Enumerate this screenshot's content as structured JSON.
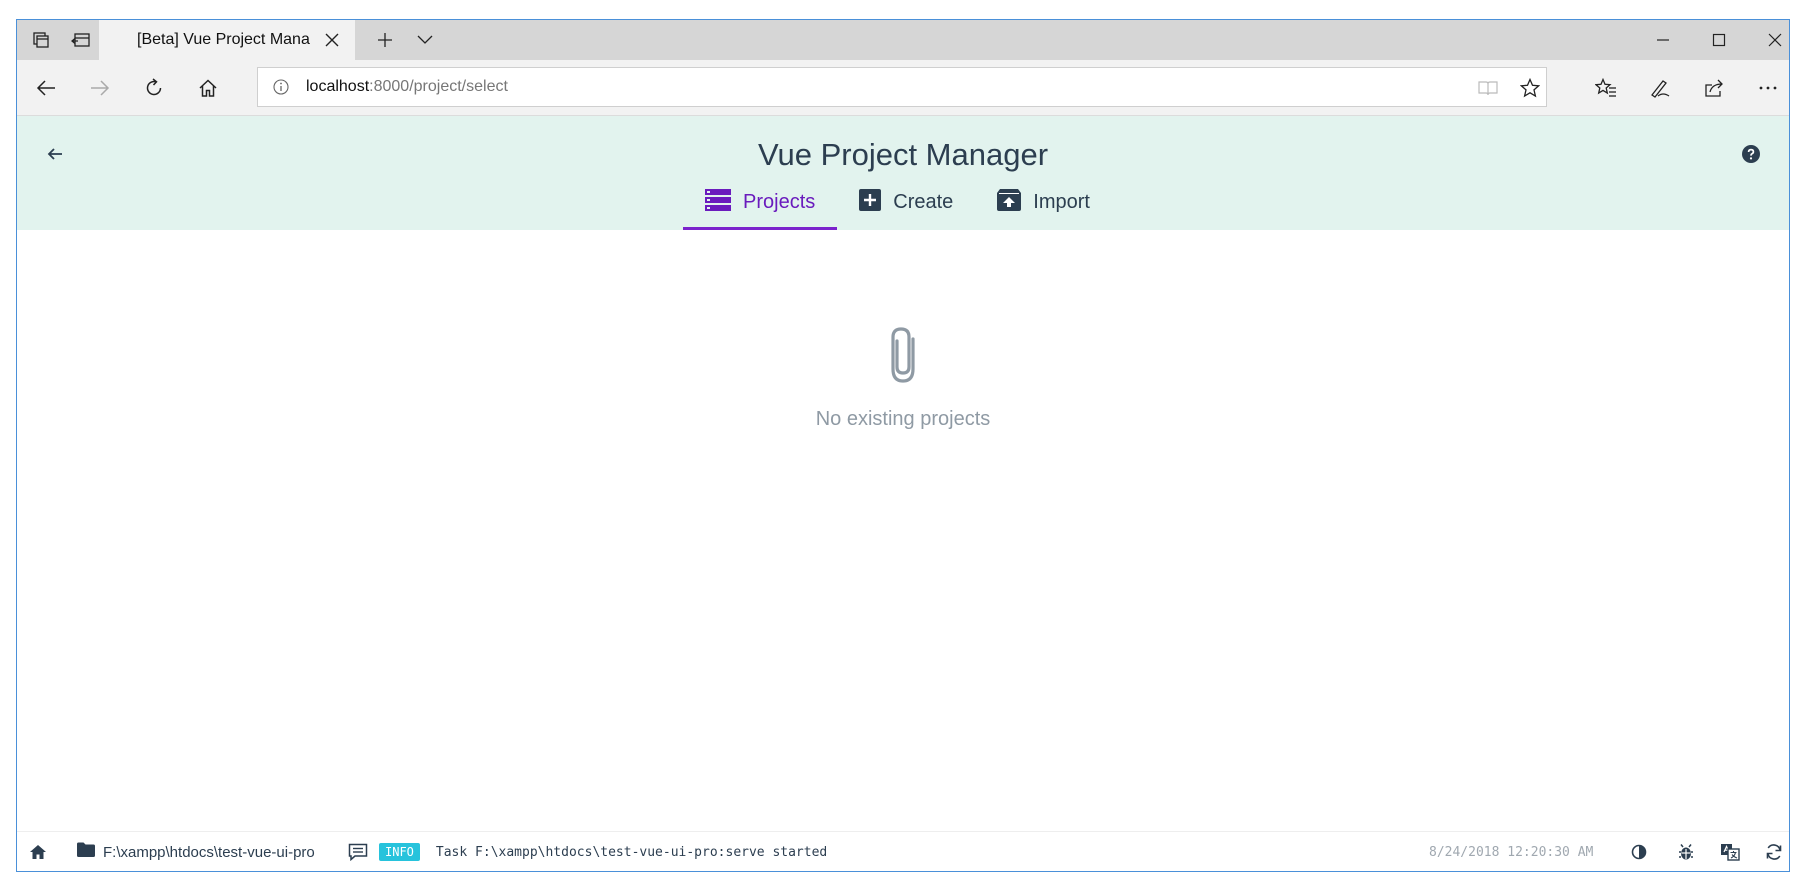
{
  "browser": {
    "tab_title": "[Beta] Vue Project Mana",
    "address_host": "localhost",
    "address_path": ":8000/project/select"
  },
  "header": {
    "title": "Vue Project Manager",
    "tabs": [
      {
        "label": "Projects",
        "icon": "projects-list-icon",
        "active": true
      },
      {
        "label": "Create",
        "icon": "plus-square-icon",
        "active": false
      },
      {
        "label": "Import",
        "icon": "unarchive-icon",
        "active": false
      }
    ]
  },
  "main": {
    "empty_text": "No existing projects",
    "empty_icon": "paperclip-icon"
  },
  "statusbar": {
    "path": "F:\\xampp\\htdocs\\test-vue-ui-pro",
    "badge": "INFO",
    "log": "Task F:\\xampp\\htdocs\\test-vue-ui-pro:serve started",
    "time": "8/24/2018 12:20:30 AM"
  },
  "colors": {
    "accent": "#6a1bbd",
    "header_bg": "#e2f3ee",
    "badge_bg": "#27c3dc",
    "text": "#2c3e50"
  }
}
